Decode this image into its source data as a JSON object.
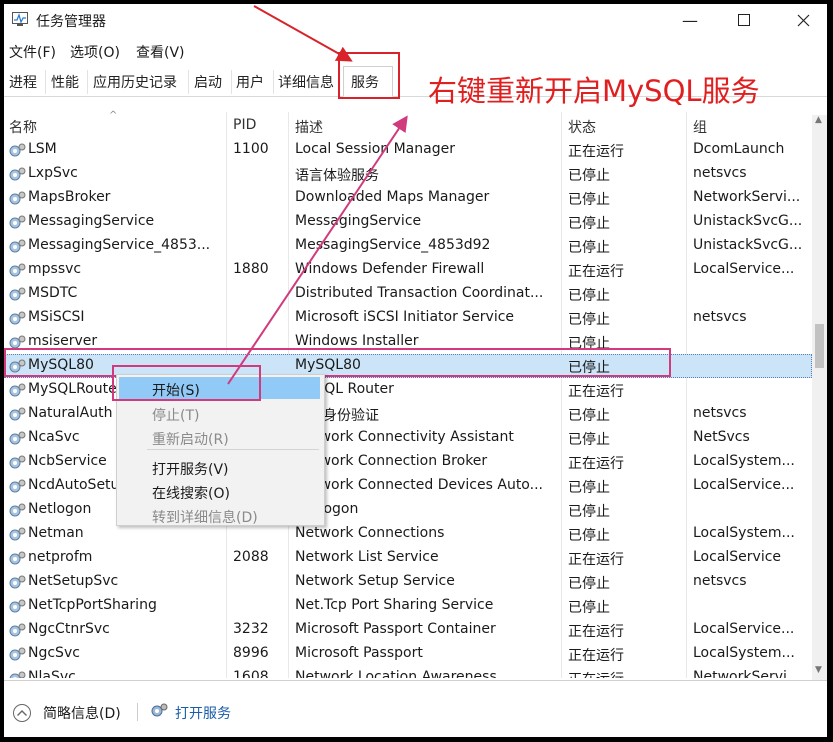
{
  "window": {
    "title": "任务管理器"
  },
  "menu": [
    "文件(F)",
    "选项(O)",
    "查看(V)"
  ],
  "tabs": [
    "进程",
    "性能",
    "应用历史记录",
    "启动",
    "用户",
    "详细信息",
    "服务"
  ],
  "annotation": "右键重新开启MySQL服务",
  "columns": [
    "名称",
    "PID",
    "描述",
    "状态",
    "组"
  ],
  "rows": [
    {
      "name": "LSM",
      "pid": "1100",
      "desc": "Local Session Manager",
      "status": "正在运行",
      "group": "DcomLaunch"
    },
    {
      "name": "LxpSvc",
      "pid": "",
      "desc": "语言体验服务",
      "status": "已停止",
      "group": "netsvcs"
    },
    {
      "name": "MapsBroker",
      "pid": "",
      "desc": "Downloaded Maps Manager",
      "status": "已停止",
      "group": "NetworkServi..."
    },
    {
      "name": "MessagingService",
      "pid": "",
      "desc": "MessagingService",
      "status": "已停止",
      "group": "UnistackSvcG..."
    },
    {
      "name": "MessagingService_4853...",
      "pid": "",
      "desc": "MessagingService_4853d92",
      "status": "已停止",
      "group": "UnistackSvcG..."
    },
    {
      "name": "mpssvc",
      "pid": "1880",
      "desc": "Windows Defender Firewall",
      "status": "正在运行",
      "group": "LocalService..."
    },
    {
      "name": "MSDTC",
      "pid": "",
      "desc": "Distributed Transaction Coordinat...",
      "status": "已停止",
      "group": ""
    },
    {
      "name": "MSiSCSI",
      "pid": "",
      "desc": "Microsoft iSCSI Initiator Service",
      "status": "已停止",
      "group": "netsvcs"
    },
    {
      "name": "msiserver",
      "pid": "",
      "desc": "Windows Installer",
      "status": "已停止",
      "group": ""
    },
    {
      "name": "MySQL80",
      "pid": "",
      "desc": "MySQL80",
      "status": "已停止",
      "group": ""
    },
    {
      "name": "MySQLRouter",
      "pid": "",
      "desc": "MySQL Router",
      "status": "正在运行",
      "group": ""
    },
    {
      "name": "NaturalAuth",
      "pid": "",
      "desc": "自然身份验证",
      "status": "已停止",
      "group": "netsvcs"
    },
    {
      "name": "NcaSvc",
      "pid": "",
      "desc": "Network Connectivity Assistant",
      "status": "已停止",
      "group": "NetSvcs"
    },
    {
      "name": "NcbService",
      "pid": "",
      "desc": "Network Connection Broker",
      "status": "正在运行",
      "group": "LocalSystem..."
    },
    {
      "name": "NcdAutoSetup",
      "pid": "",
      "desc": "Network Connected Devices Auto...",
      "status": "已停止",
      "group": "LocalService..."
    },
    {
      "name": "Netlogon",
      "pid": "",
      "desc": "Netlogon",
      "status": "已停止",
      "group": ""
    },
    {
      "name": "Netman",
      "pid": "",
      "desc": "Network Connections",
      "status": "已停止",
      "group": "LocalSystem..."
    },
    {
      "name": "netprofm",
      "pid": "2088",
      "desc": "Network List Service",
      "status": "正在运行",
      "group": "LocalService"
    },
    {
      "name": "NetSetupSvc",
      "pid": "",
      "desc": "Network Setup Service",
      "status": "已停止",
      "group": "netsvcs"
    },
    {
      "name": "NetTcpPortSharing",
      "pid": "",
      "desc": "Net.Tcp Port Sharing Service",
      "status": "已停止",
      "group": ""
    },
    {
      "name": "NgcCtnrSvc",
      "pid": "3232",
      "desc": "Microsoft Passport Container",
      "status": "正在运行",
      "group": "LocalService..."
    },
    {
      "name": "NgcSvc",
      "pid": "8996",
      "desc": "Microsoft Passport",
      "status": "正在运行",
      "group": "LocalSystem..."
    },
    {
      "name": "NlaSvc",
      "pid": "1608",
      "desc": "Network Location Awareness",
      "status": "正在运行",
      "group": "NetworkServi..."
    }
  ],
  "context_menu": {
    "start": "开始(S)",
    "stop": "停止(T)",
    "restart": "重新启动(R)",
    "open_services": "打开服务(V)",
    "search_online": "在线搜索(O)",
    "goto_details": "转到详细信息(D)"
  },
  "footer": {
    "less_details": "简略信息(D)",
    "open_services": "打开服务"
  },
  "colors": {
    "annotation_red": "#e02020",
    "selection": "#cce4f7",
    "annotation_pink": "#d23a7e"
  }
}
